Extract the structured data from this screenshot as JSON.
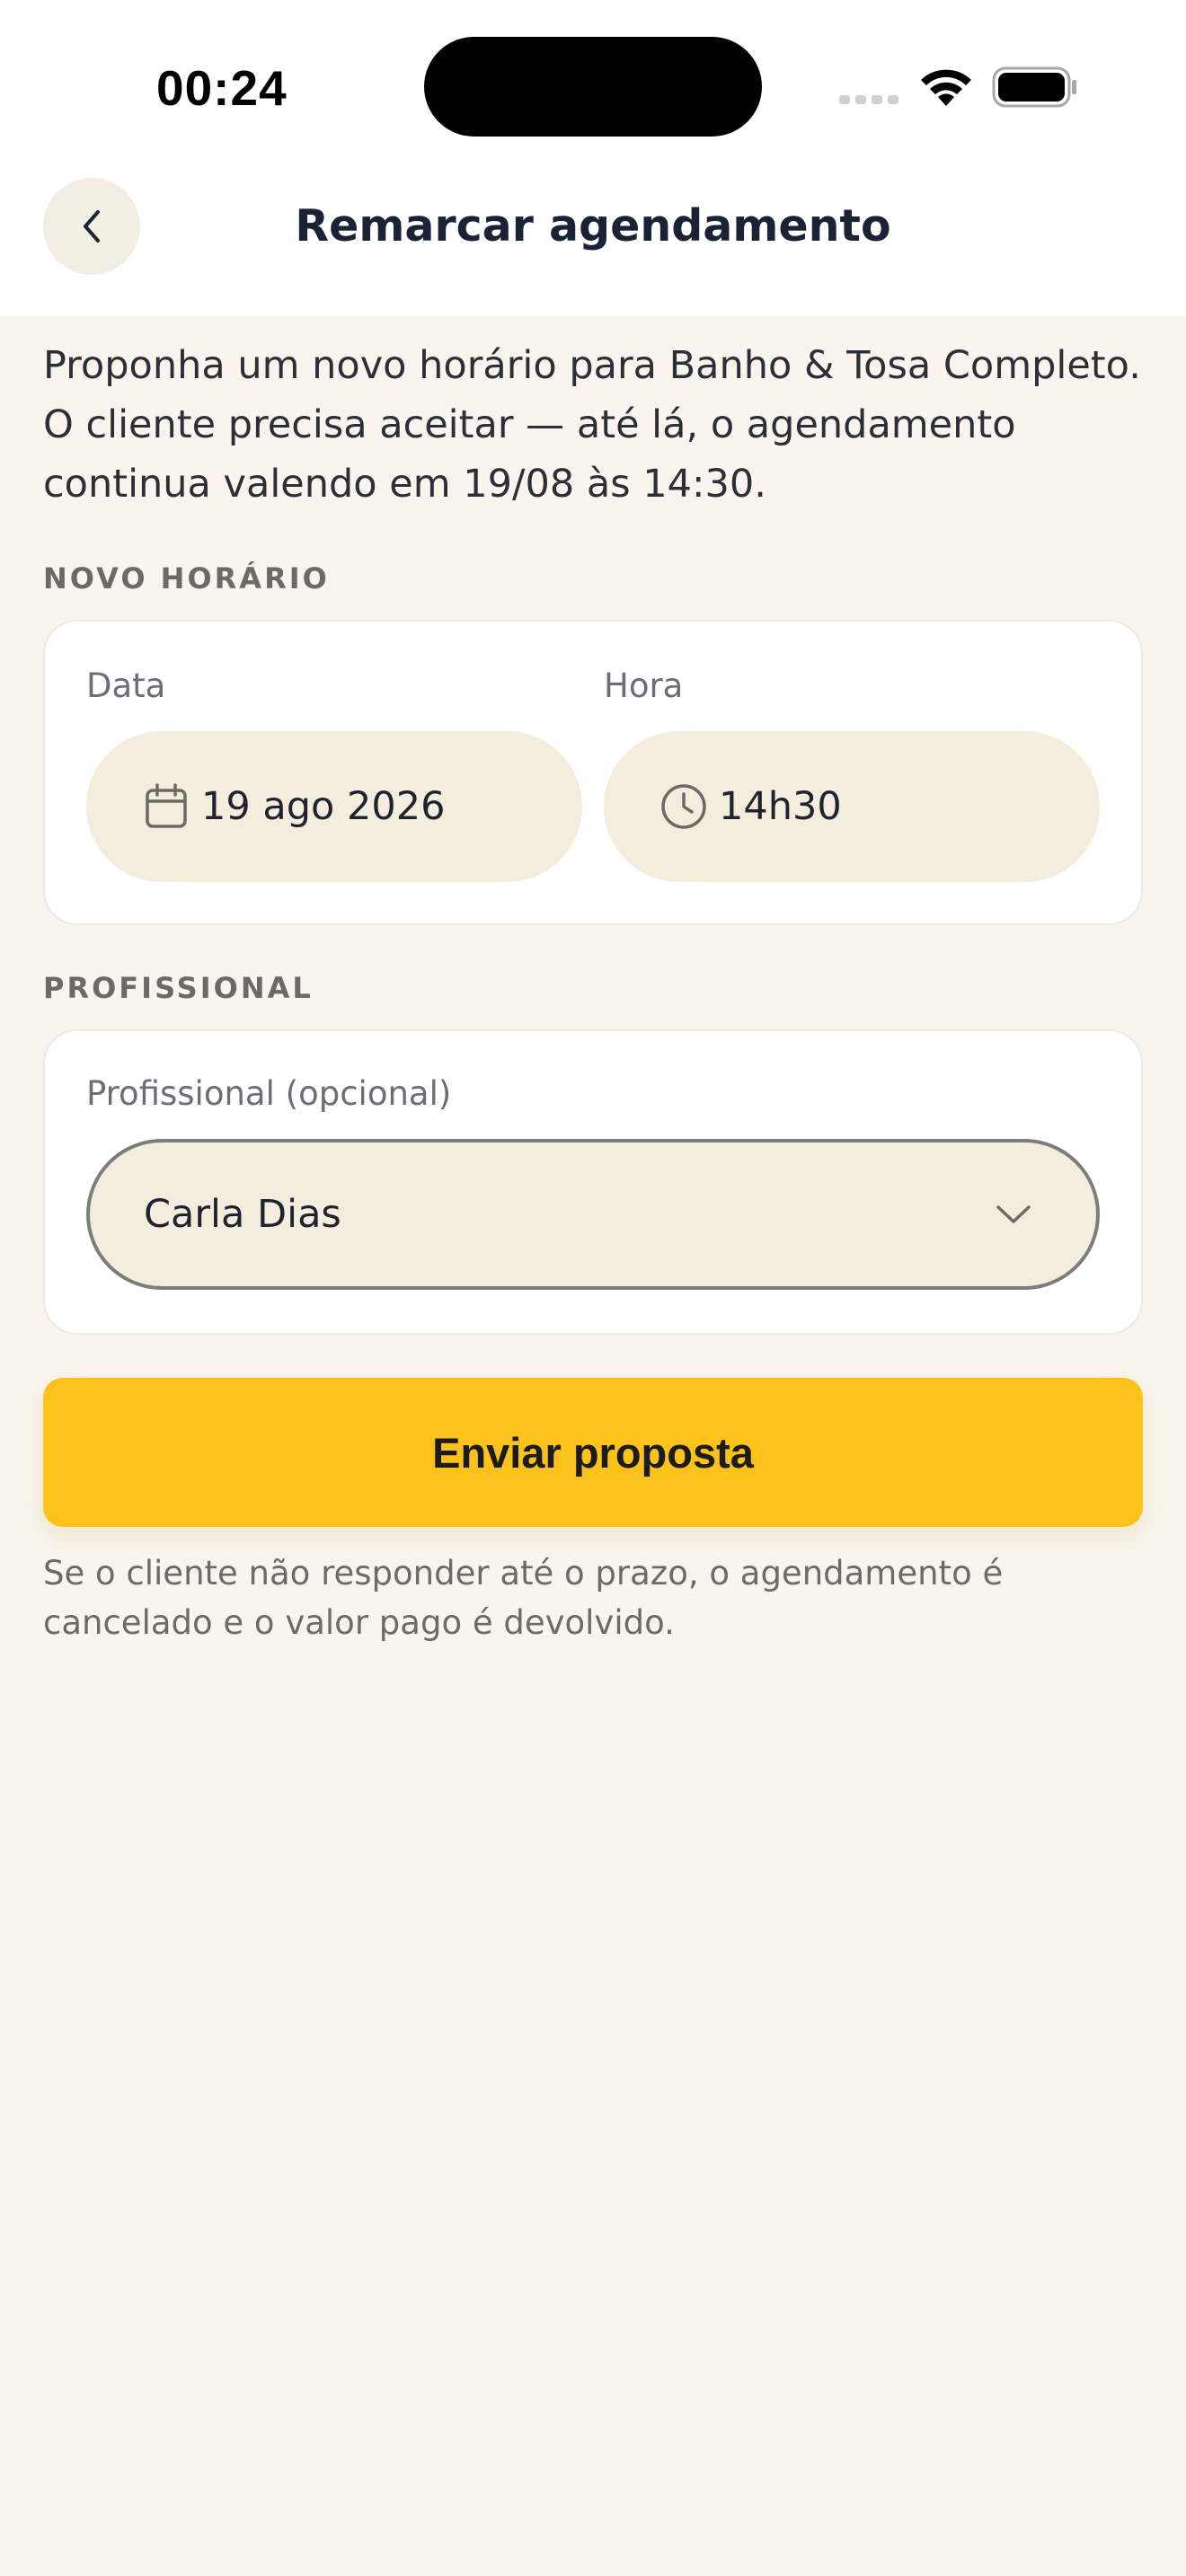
{
  "status_bar": {
    "time": "00:24",
    "icons": [
      "signal-icon",
      "wifi-icon",
      "battery-icon"
    ]
  },
  "header": {
    "back_icon": "chevron-left-icon",
    "title": "Remarcar agendamento"
  },
  "intro": "Proponha um novo horário para Banho & Tosa Completo. O cliente precisa aceitar — até lá, o agendamento continua valendo em 19/08 às 14:30.",
  "new_time_section": {
    "label": "NOVO HORÁRIO",
    "date": {
      "label": "Data",
      "value": "19 ago 2026",
      "icon": "calendar-icon"
    },
    "time": {
      "label": "Hora",
      "value": "14h30",
      "icon": "clock-icon"
    }
  },
  "professional_section": {
    "label": "PROFISSIONAL",
    "field_label": "Profissional (opcional)",
    "selected": "Carla Dias",
    "icon": "chevron-down-icon"
  },
  "submit_label": "Enviar proposta",
  "footnote": "Se o cliente não responder até o prazo, o agendamento é cancelado e o valor pago é devolvido.",
  "colors": {
    "background": "#f9f5ee",
    "accent": "#fbc21c",
    "pill": "#f4eddd",
    "title": "#1a2236"
  }
}
